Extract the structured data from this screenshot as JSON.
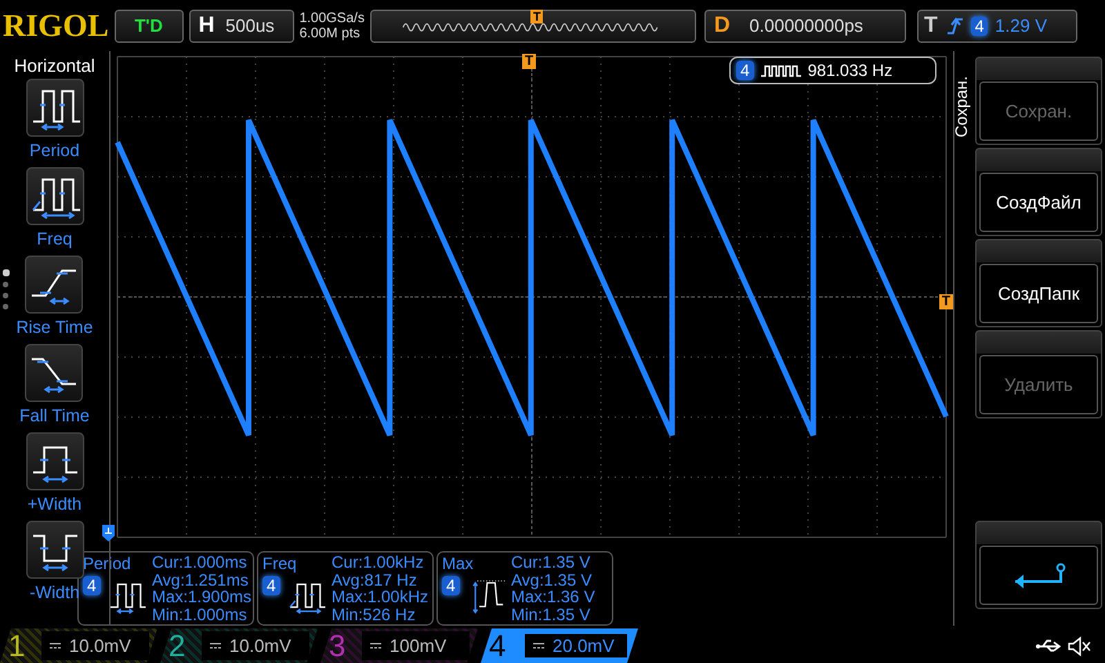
{
  "top_bar": {
    "brand": "RIGOL",
    "run_state": "T'D",
    "horizontal": {
      "label": "H",
      "timebase": "500us",
      "sample_rate": "1.00GSa/s",
      "memory_depth": "6.00M pts"
    },
    "overview_trigger_marker": "T",
    "delay": {
      "label": "D",
      "value": "0.00000000ps"
    },
    "trigger": {
      "label": "T",
      "source": "4",
      "level": "1.29 V"
    }
  },
  "left_menu": {
    "title": "Horizontal",
    "items": [
      {
        "label": "Period",
        "kind": "period"
      },
      {
        "label": "Freq",
        "kind": "freq"
      },
      {
        "label": "Rise Time",
        "kind": "rise"
      },
      {
        "label": "Fall Time",
        "kind": "fall"
      },
      {
        "label": "+Width",
        "kind": "pwidth"
      },
      {
        "label": "-Width",
        "kind": "nwidth"
      }
    ]
  },
  "display": {
    "trigger_position_marker": "T",
    "trigger_level_marker": "T",
    "frequency_counter": {
      "channel": "4",
      "value": "981.033 Hz"
    }
  },
  "right_menu": {
    "title": "Сохран.",
    "items": [
      {
        "kind": "text",
        "label": "Сохран.",
        "disabled": true
      },
      {
        "kind": "text",
        "label": "СоздФайл",
        "disabled": false
      },
      {
        "kind": "text",
        "label": "СоздПапк",
        "disabled": false
      },
      {
        "kind": "text",
        "label": "Удалить",
        "disabled": true
      },
      {
        "kind": "back",
        "disabled": false
      }
    ]
  },
  "measurements": [
    {
      "name": "Period",
      "channel": "4",
      "kind": "period",
      "lines": [
        "Cur:1.000ms",
        "Avg:1.251ms",
        "Max:1.900ms",
        "Min:1.000ms"
      ]
    },
    {
      "name": "Freq",
      "channel": "4",
      "kind": "freq",
      "lines": [
        "Cur:1.00kHz",
        "Avg:817 Hz",
        "Max:1.00kHz",
        "Min:526 Hz"
      ]
    },
    {
      "name": "Max",
      "channel": "4",
      "kind": "max",
      "lines": [
        "Cur:1.35 V",
        "Avg:1.35 V",
        "Max:1.36 V",
        "Min:1.35 V"
      ]
    }
  ],
  "channels": [
    {
      "number": "1",
      "scale": "10.0mV",
      "color": "#b8b820",
      "selected": false
    },
    {
      "number": "2",
      "scale": "10.0mV",
      "color": "#20b0a0",
      "selected": false
    },
    {
      "number": "3",
      "scale": "100mV",
      "color": "#b030b0",
      "selected": false
    },
    {
      "number": "4",
      "scale": "20.0mV",
      "color": "#1e8cff",
      "selected": true
    }
  ]
}
